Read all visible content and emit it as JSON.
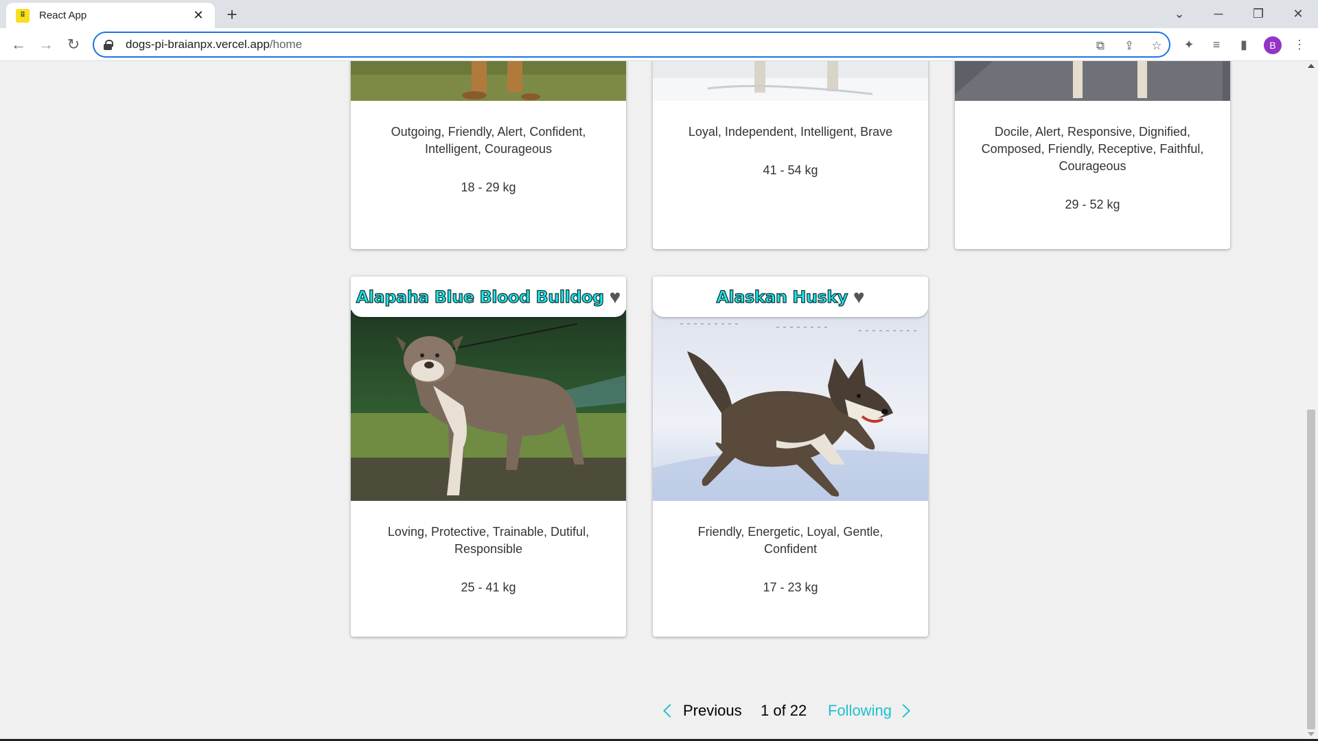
{
  "browser": {
    "tab_title": "React App",
    "tab_close": "✕",
    "new_tab": "+",
    "url_host": "dogs-pi-braianpx.vercel.app",
    "url_path": "/home",
    "profile_initial": "B"
  },
  "cards_top": [
    {
      "temperament": "Outgoing, Friendly, Alert, Confident, Intelligent, Courageous",
      "weight": "18 - 29 kg"
    },
    {
      "temperament": "Loyal, Independent, Intelligent, Brave",
      "weight": "41 - 54 kg"
    },
    {
      "temperament": "Docile, Alert, Responsive, Dignified, Composed, Friendly, Receptive, Faithful, Courageous",
      "weight": "29 - 52 kg"
    }
  ],
  "cards_bottom": [
    {
      "name": "Alapaha Blue Blood Bulldog",
      "heart": "♥",
      "temperament": "Loving, Protective, Trainable, Dutiful, Responsible",
      "weight": "25 - 41 kg"
    },
    {
      "name": "Alaskan Husky",
      "heart": "♥",
      "temperament": "Friendly, Energetic, Loyal, Gentle, Confident",
      "weight": "17 - 23 kg"
    }
  ],
  "pagination": {
    "previous_label": "Previous",
    "page_info": "1 of 22",
    "next_label": "Following"
  },
  "colors": {
    "breed_name": "#22e3e8",
    "pager_accent": "#1cc2cc",
    "page_bg": "#f0f0f0"
  }
}
